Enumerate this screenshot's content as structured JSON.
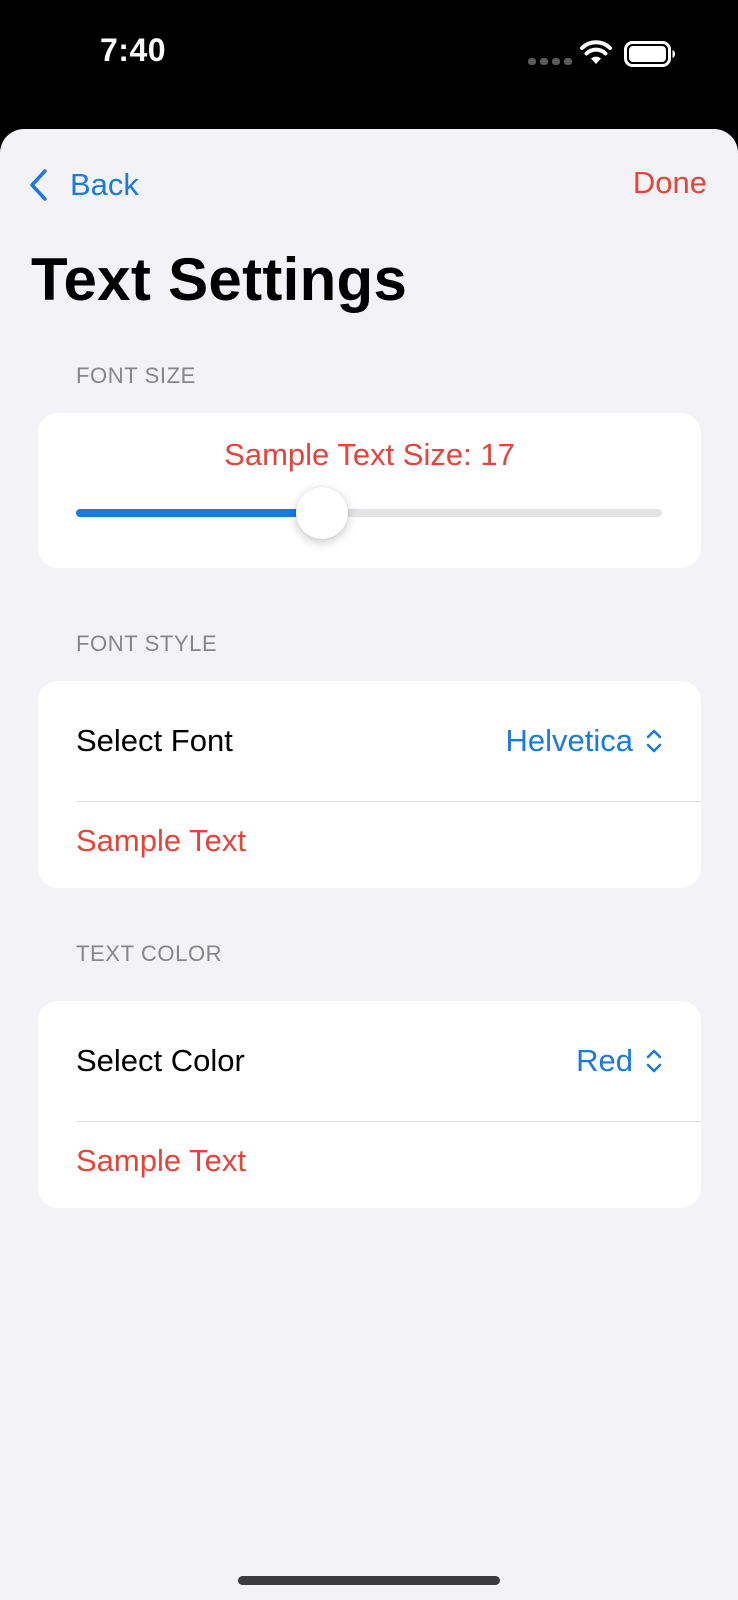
{
  "status_bar": {
    "time": "7:40"
  },
  "nav": {
    "back_label": "Back",
    "done_label": "Done"
  },
  "title": "Text Settings",
  "font_size_section": {
    "header": "FONT SIZE",
    "sample_label": "Sample Text Size: 17",
    "slider_value_fraction": 0.42
  },
  "font_style_section": {
    "header": "FONT STYLE",
    "row_label": "Select Font",
    "selected_font": "Helvetica",
    "sample_text": "Sample Text"
  },
  "text_color_section": {
    "header": "TEXT COLOR",
    "row_label": "Select Color",
    "selected_color": "Red",
    "sample_text": "Sample Text"
  },
  "colors": {
    "accent": "#1a7ae0",
    "sample_text": "#e5443a",
    "background": "#f2f2f7"
  }
}
